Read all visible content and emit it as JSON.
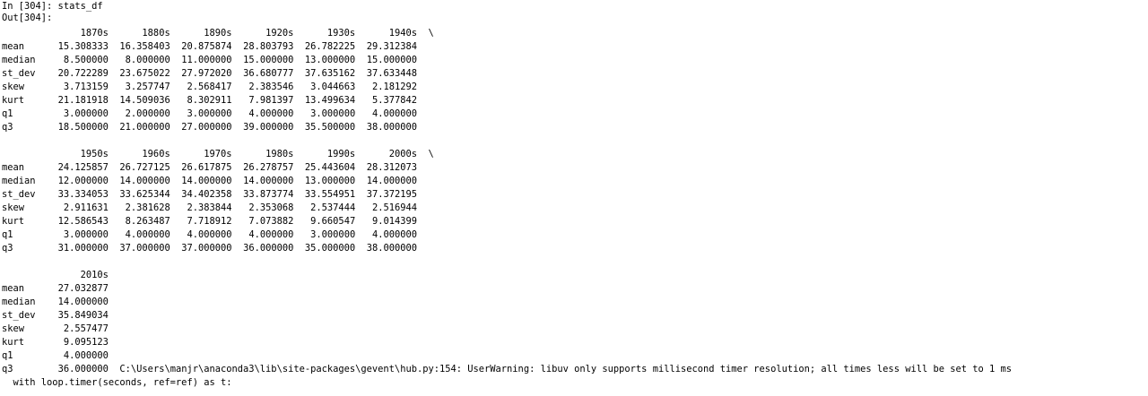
{
  "input_prompt": "In [304]: stats_df",
  "output_prompt": "Out[304]:",
  "blocks": [
    {
      "columns": [
        "1870s",
        "1880s",
        "1890s",
        "1920s",
        "1930s",
        "1940s"
      ],
      "continuation": "\\",
      "rows": [
        {
          "label": "mean",
          "values": [
            "15.308333",
            "16.358403",
            "20.875874",
            "28.803793",
            "26.782225",
            "29.312384"
          ]
        },
        {
          "label": "median",
          "values": [
            "8.500000",
            "8.000000",
            "11.000000",
            "15.000000",
            "13.000000",
            "15.000000"
          ]
        },
        {
          "label": "st_dev",
          "values": [
            "20.722289",
            "23.675022",
            "27.972020",
            "36.680777",
            "37.635162",
            "37.633448"
          ]
        },
        {
          "label": "skew",
          "values": [
            "3.713159",
            "3.257747",
            "2.568417",
            "2.383546",
            "3.044663",
            "2.181292"
          ]
        },
        {
          "label": "kurt",
          "values": [
            "21.181918",
            "14.509036",
            "8.302911",
            "7.981397",
            "13.499634",
            "5.377842"
          ]
        },
        {
          "label": "q1",
          "values": [
            "3.000000",
            "2.000000",
            "3.000000",
            "4.000000",
            "3.000000",
            "4.000000"
          ]
        },
        {
          "label": "q3",
          "values": [
            "18.500000",
            "21.000000",
            "27.000000",
            "39.000000",
            "35.500000",
            "38.000000"
          ]
        }
      ]
    },
    {
      "columns": [
        "1950s",
        "1960s",
        "1970s",
        "1980s",
        "1990s",
        "2000s"
      ],
      "continuation": "\\",
      "rows": [
        {
          "label": "mean",
          "values": [
            "24.125857",
            "26.727125",
            "26.617875",
            "26.278757",
            "25.443604",
            "28.312073"
          ]
        },
        {
          "label": "median",
          "values": [
            "12.000000",
            "14.000000",
            "14.000000",
            "14.000000",
            "13.000000",
            "14.000000"
          ]
        },
        {
          "label": "st_dev",
          "values": [
            "33.334053",
            "33.625344",
            "34.402358",
            "33.873774",
            "33.554951",
            "37.372195"
          ]
        },
        {
          "label": "skew",
          "values": [
            "2.911631",
            "2.381628",
            "2.383844",
            "2.353068",
            "2.537444",
            "2.516944"
          ]
        },
        {
          "label": "kurt",
          "values": [
            "12.586543",
            "8.263487",
            "7.718912",
            "7.073882",
            "9.660547",
            "9.014399"
          ]
        },
        {
          "label": "q1",
          "values": [
            "3.000000",
            "4.000000",
            "4.000000",
            "4.000000",
            "3.000000",
            "4.000000"
          ]
        },
        {
          "label": "q3",
          "values": [
            "31.000000",
            "37.000000",
            "37.000000",
            "36.000000",
            "35.000000",
            "38.000000"
          ]
        }
      ]
    },
    {
      "columns": [
        "2010s"
      ],
      "continuation": "",
      "rows": [
        {
          "label": "mean",
          "values": [
            "27.032877"
          ]
        },
        {
          "label": "median",
          "values": [
            "14.000000"
          ]
        },
        {
          "label": "st_dev",
          "values": [
            "35.849034"
          ]
        },
        {
          "label": "skew",
          "values": [
            "2.557477"
          ]
        },
        {
          "label": "kurt",
          "values": [
            "9.095123"
          ]
        },
        {
          "label": "q1",
          "values": [
            "4.000000"
          ]
        },
        {
          "label": "q3",
          "values": [
            "36.000000"
          ]
        }
      ]
    }
  ],
  "warning_inline": "C:\\Users\\manjr\\anaconda3\\lib\\site-packages\\gevent\\hub.py:154: UserWarning: libuv only supports millisecond timer resolution; all times less will be set to 1 ms",
  "warning_line2": "  with loop.timer(seconds, ref=ref) as t:"
}
